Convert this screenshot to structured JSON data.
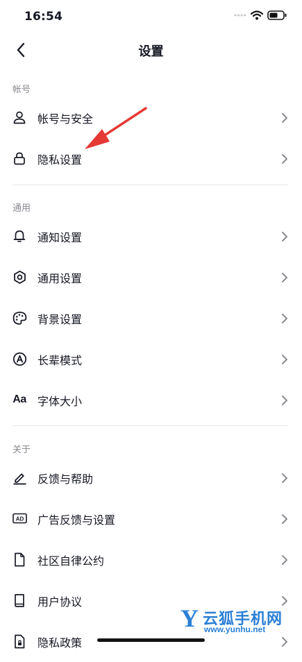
{
  "status_bar": {
    "time": "16:54"
  },
  "nav": {
    "title": "设置"
  },
  "sections": {
    "account": {
      "label": "帐号",
      "items": [
        {
          "label": "帐号与安全",
          "icon": "person-icon"
        },
        {
          "label": "隐私设置",
          "icon": "lock-icon"
        }
      ]
    },
    "general": {
      "label": "通用",
      "items": [
        {
          "label": "通知设置",
          "icon": "bell-icon"
        },
        {
          "label": "通用设置",
          "icon": "gear-icon"
        },
        {
          "label": "背景设置",
          "icon": "palette-icon"
        },
        {
          "label": "长辈模式",
          "icon": "elder-mode-icon"
        },
        {
          "label": "字体大小",
          "icon": "font-size-icon",
          "glyph": "Aa"
        }
      ]
    },
    "about": {
      "label": "关于",
      "items": [
        {
          "label": "反馈与帮助",
          "icon": "pencil-icon"
        },
        {
          "label": "广告反馈与设置",
          "icon": "ad-icon",
          "glyph": "AD"
        },
        {
          "label": "社区自律公约",
          "icon": "document-icon"
        },
        {
          "label": "用户协议",
          "icon": "book-icon"
        },
        {
          "label": "隐私政策",
          "icon": "privacy-document-icon"
        }
      ]
    }
  },
  "watermark": {
    "brand": "云狐手机网",
    "url": "www.yunhu.net",
    "logo_letter": "Y"
  },
  "colors": {
    "annotation_arrow": "#e53935",
    "watermark": "#2b7fd6",
    "text": "#161823",
    "secondary_text": "#8a8b91"
  }
}
